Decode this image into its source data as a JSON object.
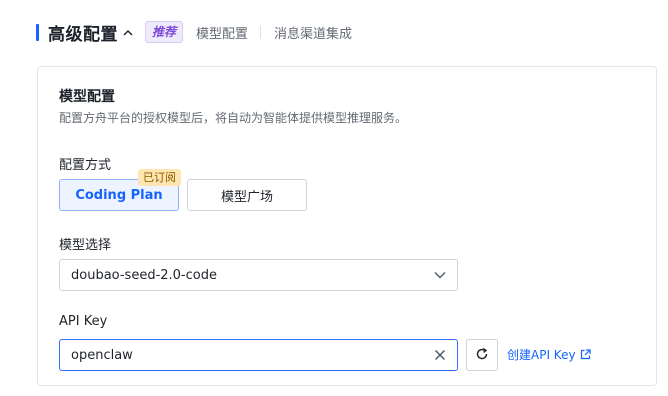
{
  "header": {
    "title": "高级配置",
    "tag": "推荐",
    "links": [
      "模型配置",
      "消息渠道集成"
    ]
  },
  "card": {
    "title": "模型配置",
    "description": "配置方舟平台的授权模型后，将自动为智能体提供模型推理服务。"
  },
  "config_mode": {
    "label": "配置方式",
    "options": [
      "Coding Plan",
      "模型广场"
    ],
    "selected": "Coding Plan",
    "badge": "已订阅"
  },
  "model_select": {
    "label": "模型选择",
    "value": "doubao-seed-2.0-code"
  },
  "api_key": {
    "label": "API Key",
    "value": "openclaw",
    "create_link": "创建API Key"
  },
  "colors": {
    "accent": "#1664ff",
    "tag_purple": "#7b4bd8",
    "badge_bg": "#ffe6b0"
  },
  "icons": [
    "chevron-up-icon",
    "chevron-down-icon",
    "clear-icon",
    "refresh-icon",
    "external-link-icon"
  ]
}
